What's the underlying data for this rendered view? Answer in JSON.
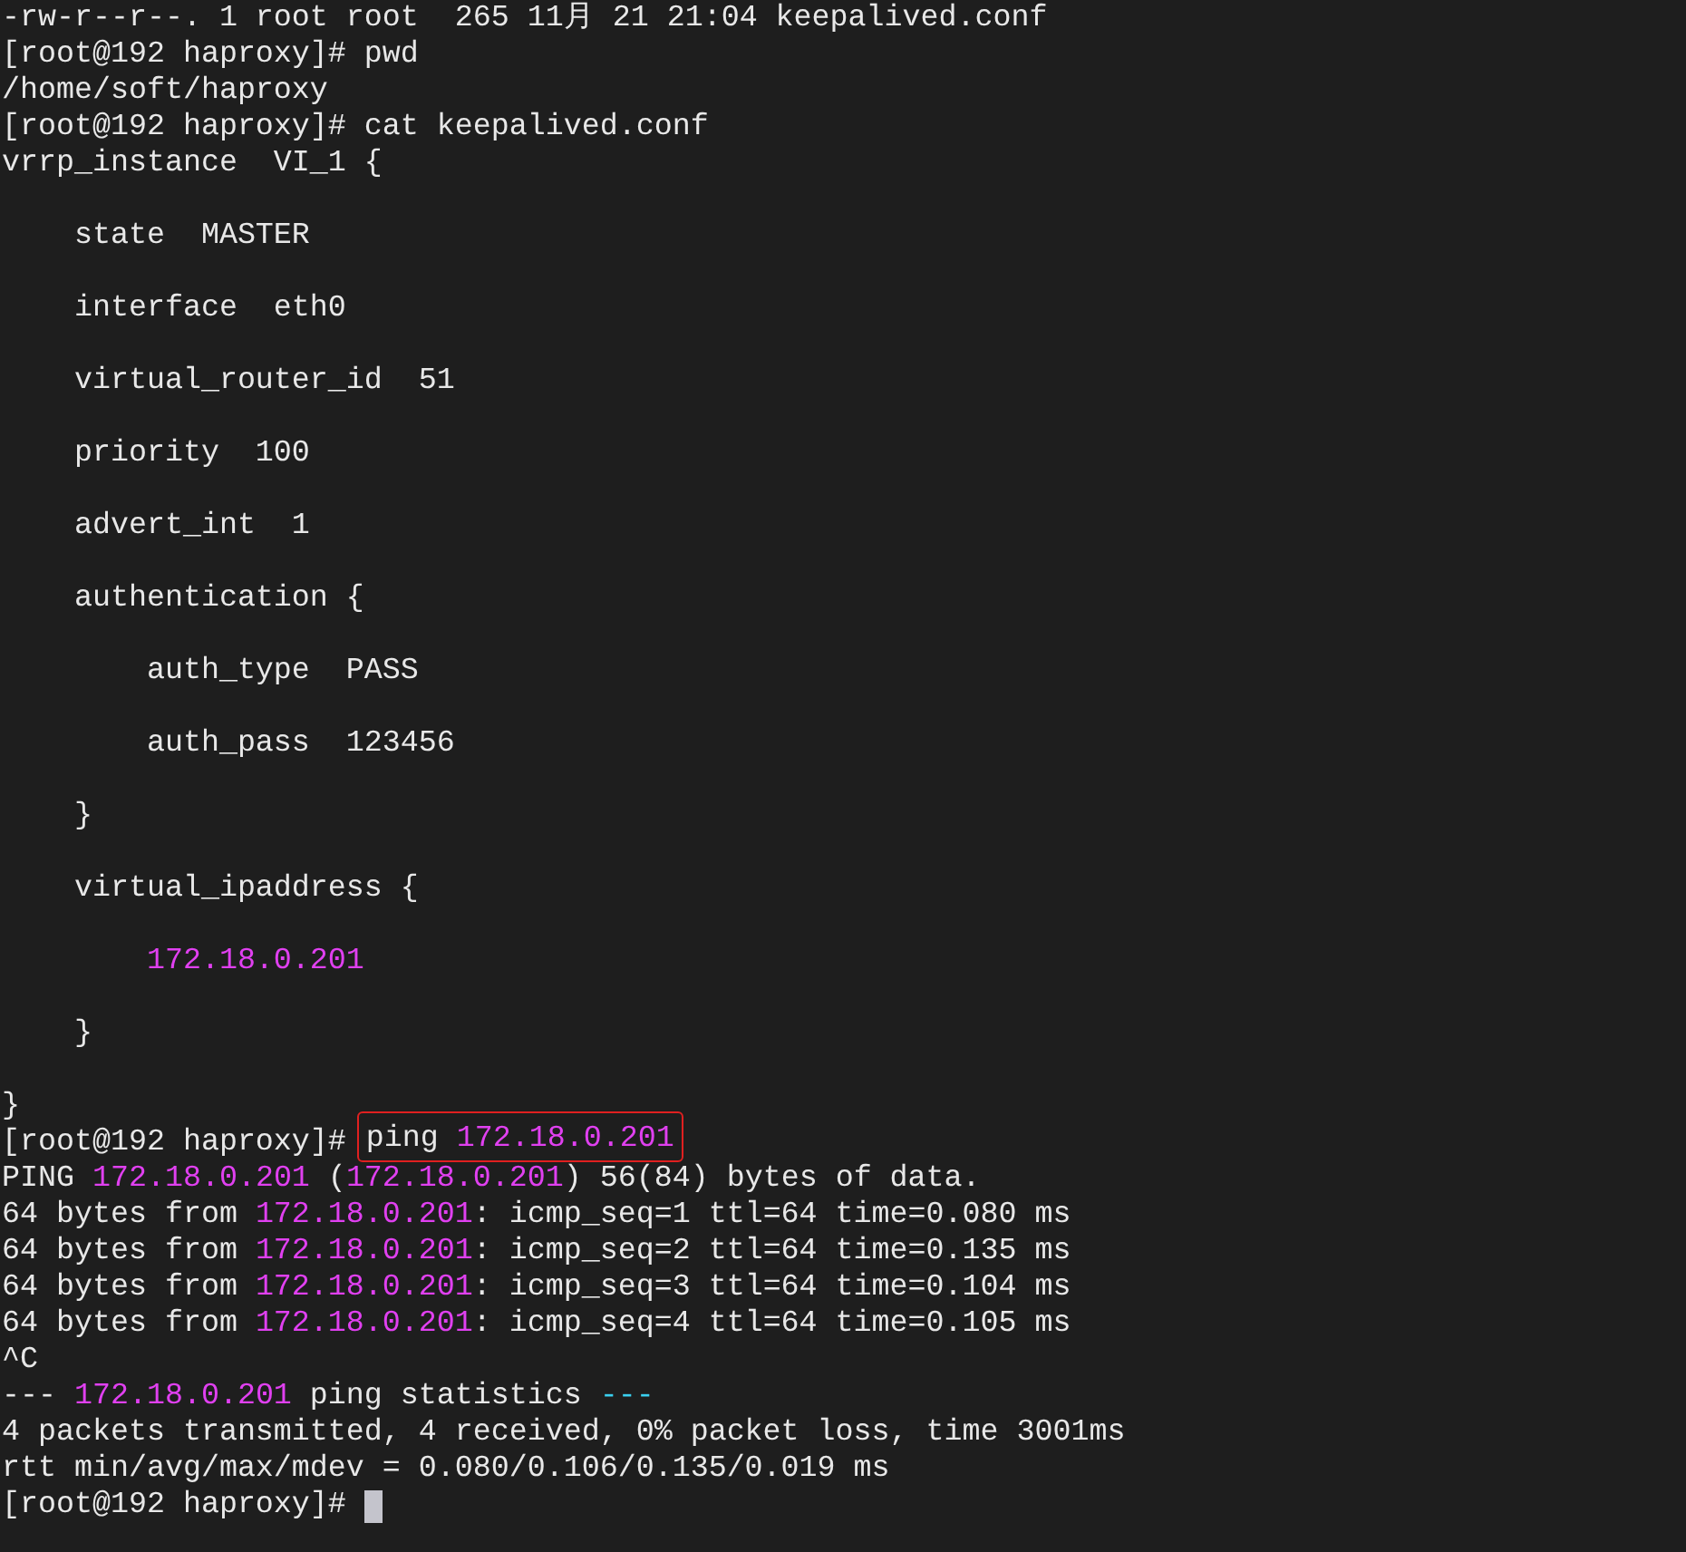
{
  "terminal": {
    "lines": [
      {
        "kind": "text",
        "segments": [
          {
            "text": "-rw-r--r--. 1 root root  265 11月 21 21:04 keepalived.conf",
            "kind": "plain"
          }
        ]
      },
      {
        "kind": "text",
        "segments": [
          {
            "text": "[root@192 haproxy]# pwd",
            "kind": "plain"
          }
        ]
      },
      {
        "kind": "text",
        "segments": [
          {
            "text": "/home/soft/haproxy",
            "kind": "plain"
          }
        ]
      },
      {
        "kind": "text",
        "segments": [
          {
            "text": "[root@192 haproxy]# cat keepalived.conf",
            "kind": "plain"
          }
        ]
      },
      {
        "kind": "text",
        "segments": [
          {
            "text": "vrrp_instance  VI_1 {",
            "kind": "plain"
          }
        ]
      },
      {
        "kind": "blank"
      },
      {
        "kind": "text",
        "segments": [
          {
            "text": "    state  MASTER",
            "kind": "plain"
          }
        ]
      },
      {
        "kind": "blank"
      },
      {
        "kind": "text",
        "segments": [
          {
            "text": "    interface  eth0",
            "kind": "plain"
          }
        ]
      },
      {
        "kind": "blank"
      },
      {
        "kind": "text",
        "segments": [
          {
            "text": "    virtual_router_id  51",
            "kind": "plain"
          }
        ]
      },
      {
        "kind": "blank"
      },
      {
        "kind": "text",
        "segments": [
          {
            "text": "    priority  100",
            "kind": "plain"
          }
        ]
      },
      {
        "kind": "blank"
      },
      {
        "kind": "text",
        "segments": [
          {
            "text": "    advert_int  1",
            "kind": "plain"
          }
        ]
      },
      {
        "kind": "blank"
      },
      {
        "kind": "text",
        "segments": [
          {
            "text": "    authentication {",
            "kind": "plain"
          }
        ]
      },
      {
        "kind": "blank"
      },
      {
        "kind": "text",
        "segments": [
          {
            "text": "        auth_type  PASS",
            "kind": "plain"
          }
        ]
      },
      {
        "kind": "blank"
      },
      {
        "kind": "text",
        "segments": [
          {
            "text": "        auth_pass  123456",
            "kind": "plain"
          }
        ]
      },
      {
        "kind": "blank"
      },
      {
        "kind": "text",
        "segments": [
          {
            "text": "    }",
            "kind": "plain"
          }
        ]
      },
      {
        "kind": "blank"
      },
      {
        "kind": "text",
        "segments": [
          {
            "text": "    virtual_ipaddress {",
            "kind": "plain"
          }
        ]
      },
      {
        "kind": "blank"
      },
      {
        "kind": "text",
        "segments": [
          {
            "text": "        172.18.0.201",
            "kind": "ip"
          }
        ]
      },
      {
        "kind": "blank"
      },
      {
        "kind": "text",
        "segments": [
          {
            "text": "    }",
            "kind": "plain"
          }
        ]
      },
      {
        "kind": "blank"
      },
      {
        "kind": "text",
        "segments": [
          {
            "text": "}",
            "kind": "plain"
          }
        ]
      },
      {
        "kind": "boxed",
        "prompt": "[root@192 haproxy]#",
        "segments": [
          {
            "text": "ping ",
            "kind": "plain"
          },
          {
            "text": "172.18.0.201",
            "kind": "ip"
          }
        ]
      },
      {
        "kind": "text",
        "segments": [
          {
            "text": "PING ",
            "kind": "plain"
          },
          {
            "text": "172.18.0.201",
            "kind": "ip"
          },
          {
            "text": " (",
            "kind": "plain"
          },
          {
            "text": "172.18.0.201",
            "kind": "ip"
          },
          {
            "text": ") 56(84) bytes of data.",
            "kind": "plain"
          }
        ]
      },
      {
        "kind": "text",
        "segments": [
          {
            "text": "64 bytes from ",
            "kind": "plain"
          },
          {
            "text": "172.18.0.201",
            "kind": "ip"
          },
          {
            "text": ": icmp_seq=1 ttl=64 time=0.080 ms",
            "kind": "plain"
          }
        ]
      },
      {
        "kind": "text",
        "segments": [
          {
            "text": "64 bytes from ",
            "kind": "plain"
          },
          {
            "text": "172.18.0.201",
            "kind": "ip"
          },
          {
            "text": ": icmp_seq=2 ttl=64 time=0.135 ms",
            "kind": "plain"
          }
        ]
      },
      {
        "kind": "text",
        "segments": [
          {
            "text": "64 bytes from ",
            "kind": "plain"
          },
          {
            "text": "172.18.0.201",
            "kind": "ip"
          },
          {
            "text": ": icmp_seq=3 ttl=64 time=0.104 ms",
            "kind": "plain"
          }
        ]
      },
      {
        "kind": "text",
        "segments": [
          {
            "text": "64 bytes from ",
            "kind": "plain"
          },
          {
            "text": "172.18.0.201",
            "kind": "ip"
          },
          {
            "text": ": icmp_seq=4 ttl=64 time=0.105 ms",
            "kind": "plain"
          }
        ]
      },
      {
        "kind": "text",
        "segments": [
          {
            "text": "^C",
            "kind": "plain"
          }
        ]
      },
      {
        "kind": "text",
        "segments": [
          {
            "text": "--- ",
            "kind": "plain"
          },
          {
            "text": "172.18.0.201",
            "kind": "ip"
          },
          {
            "text": " ping statistics ",
            "kind": "plain"
          },
          {
            "text": "---",
            "kind": "accent"
          }
        ]
      },
      {
        "kind": "text",
        "segments": [
          {
            "text": "4 packets transmitted, 4 received, 0% packet loss, time 3001ms",
            "kind": "plain"
          }
        ]
      },
      {
        "kind": "text",
        "segments": [
          {
            "text": "rtt min/avg/max/mdev = 0.080/0.106/0.135/0.019 ms",
            "kind": "plain"
          }
        ]
      },
      {
        "kind": "prompt",
        "prompt": "[root@192 haproxy]#",
        "cursor": true
      }
    ]
  }
}
